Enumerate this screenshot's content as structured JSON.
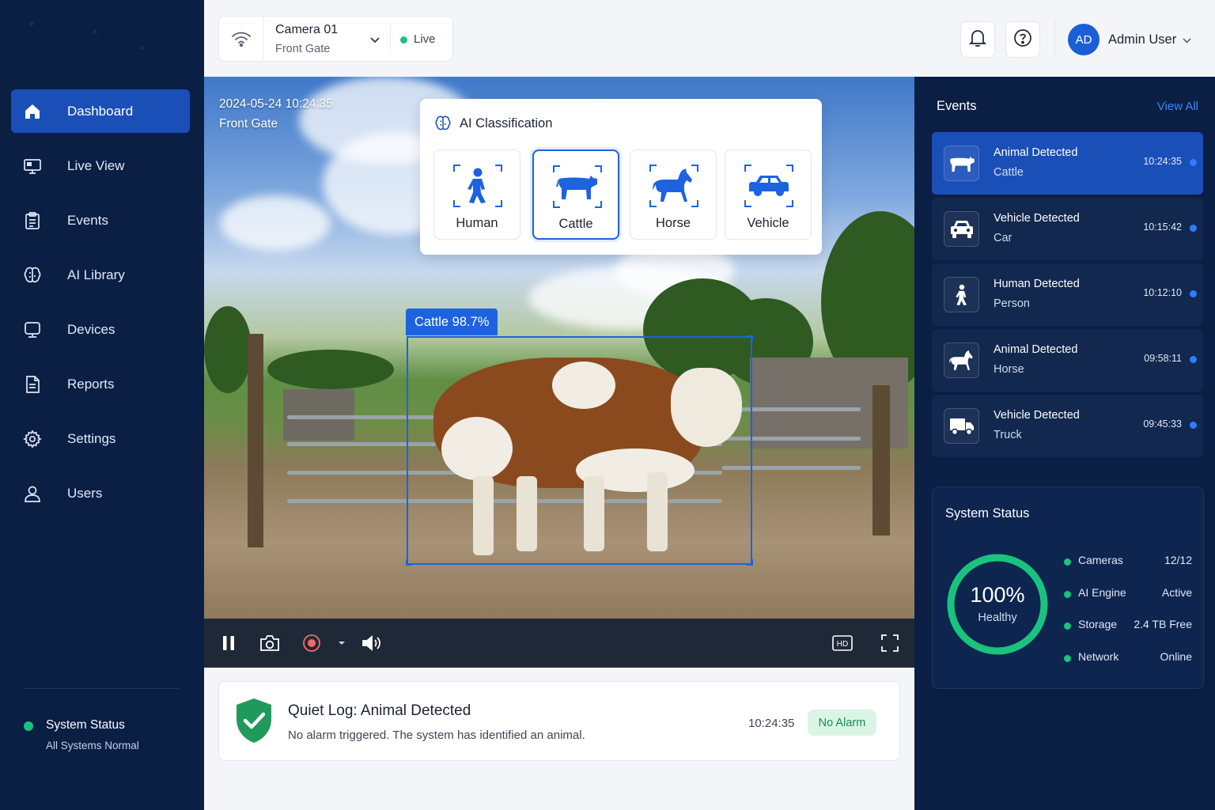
{
  "colors": {
    "sidebar_bg": "#0b1f45",
    "accent": "#1b4fb8",
    "detection": "#1d63e0",
    "success": "#19c37d"
  },
  "camera": {
    "name": "Camera 01",
    "location": "Front Gate",
    "status": "Live"
  },
  "header": {
    "avatar_initials": "AD",
    "user_name": "Admin User",
    "icons": [
      "bell-icon",
      "help-icon"
    ]
  },
  "sidebar": {
    "items": [
      {
        "label": "Dashboard",
        "icon": "home-icon",
        "active": true
      },
      {
        "label": "Live View",
        "icon": "monitor-icon",
        "active": false
      },
      {
        "label": "Events",
        "icon": "clipboard-icon",
        "active": false
      },
      {
        "label": "AI Library",
        "icon": "brain-icon",
        "active": false
      },
      {
        "label": "Devices",
        "icon": "device-icon",
        "active": false
      },
      {
        "label": "Reports",
        "icon": "report-icon",
        "active": false
      },
      {
        "label": "Settings",
        "icon": "gear-icon",
        "active": false
      },
      {
        "label": "Users",
        "icon": "user-icon",
        "active": false
      }
    ],
    "status": {
      "title": "System Status",
      "subtitle": "All Systems Normal"
    }
  },
  "video": {
    "timestamp": "2024-05-24 10:24:35",
    "location": "Front Gate",
    "detection_label": "Cattle 98.7%",
    "ai_panel": {
      "title": "AI Classification",
      "classes": [
        {
          "label": "Human",
          "icon": "person-icon",
          "selected": false
        },
        {
          "label": "Cattle",
          "icon": "cow-icon",
          "selected": true
        },
        {
          "label": "Horse",
          "icon": "horse-icon",
          "selected": false
        },
        {
          "label": "Vehicle",
          "icon": "car-icon",
          "selected": false
        }
      ]
    },
    "controls": {
      "hd_label": "HD",
      "icons": [
        "pause-icon",
        "camera-snapshot-icon",
        "record-icon",
        "caret-down-icon",
        "volume-icon",
        "hd-icon",
        "fullscreen-icon"
      ]
    }
  },
  "log": {
    "title": "Quiet Log: Animal Detected",
    "description": "No alarm triggered. The system has identified an animal.",
    "time": "10:24:35",
    "badge": "No Alarm"
  },
  "events": {
    "title": "Events",
    "view_all": "View All",
    "items": [
      {
        "title": "Animal Detected",
        "subtitle": "Cattle",
        "time": "10:24:35",
        "icon": "cow-icon",
        "active": true
      },
      {
        "title": "Vehicle Detected",
        "subtitle": "Car",
        "time": "10:15:42",
        "icon": "car-icon",
        "active": false
      },
      {
        "title": "Human Detected",
        "subtitle": "Person",
        "time": "10:12:10",
        "icon": "person-icon",
        "active": false
      },
      {
        "title": "Animal Detected",
        "subtitle": "Horse",
        "time": "09:58:11",
        "icon": "horse-icon",
        "active": false
      },
      {
        "title": "Vehicle Detected",
        "subtitle": "Truck",
        "time": "09:45:33",
        "icon": "truck-icon",
        "active": false
      }
    ]
  },
  "system_status": {
    "title": "System Status",
    "health_value": "100%",
    "health_fraction": 1.0,
    "health_label": "Healthy",
    "rows": [
      {
        "label": "Cameras",
        "value": "12/12"
      },
      {
        "label": "AI Engine",
        "value": "Active"
      },
      {
        "label": "Storage",
        "value": "2.4 TB Free"
      },
      {
        "label": "Network",
        "value": "Online"
      }
    ]
  }
}
